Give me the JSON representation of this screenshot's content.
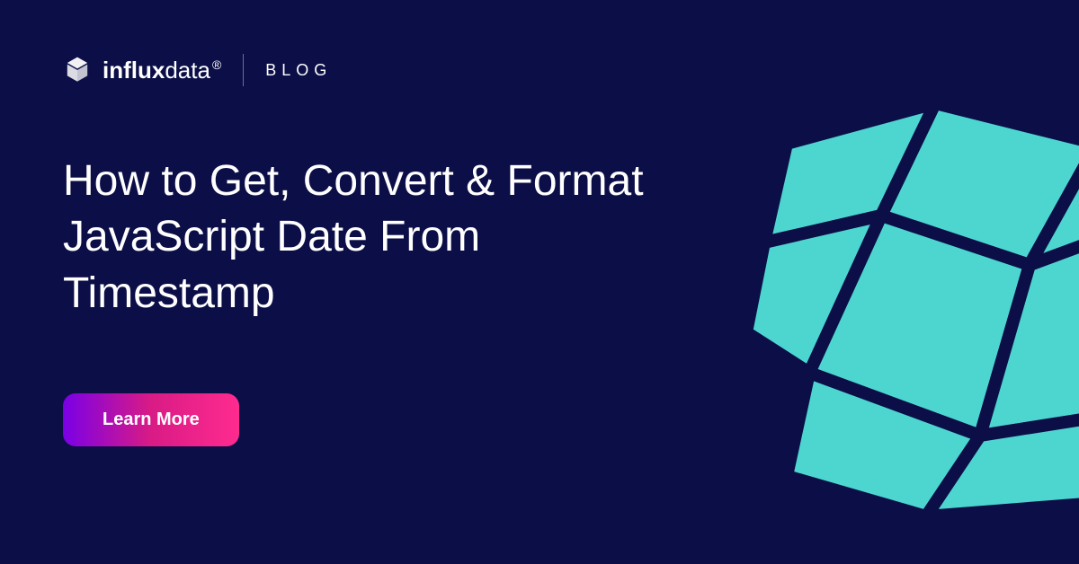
{
  "header": {
    "brand_prefix": "influx",
    "brand_suffix": "data",
    "registered": "®",
    "section_label": "BLOG"
  },
  "title": "How to Get, Convert & Format JavaScript Date From Timestamp",
  "cta": {
    "label": "Learn More"
  },
  "colors": {
    "background": "#0c0e47",
    "accent": "#4dd6d0",
    "text": "#ffffff"
  }
}
